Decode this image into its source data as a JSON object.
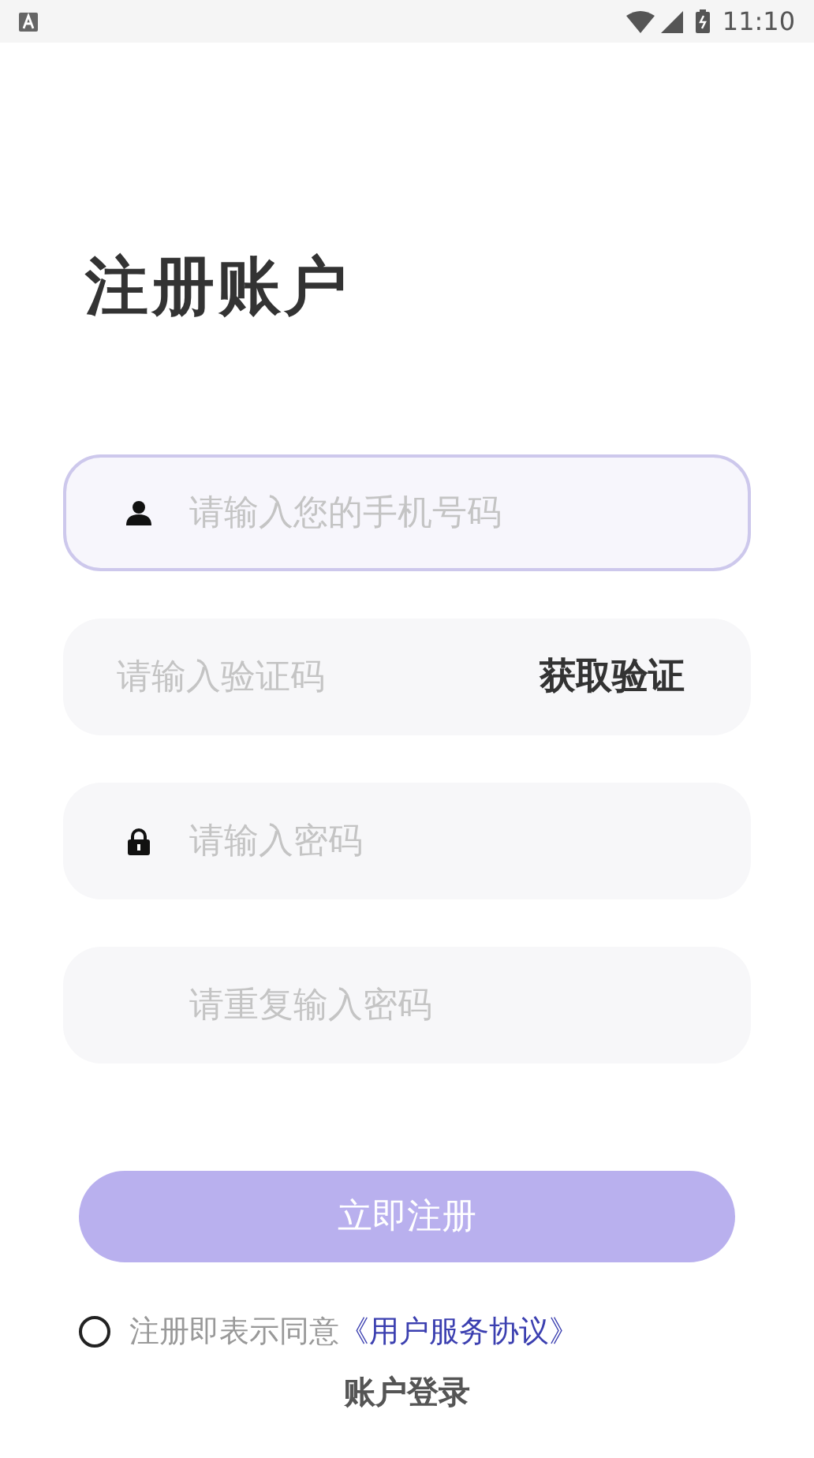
{
  "status_bar": {
    "time": "11:10"
  },
  "title": "注册账户",
  "fields": [
    {
      "kind": "phone",
      "placeholder": "请输入您的手机号码",
      "focused": true
    },
    {
      "kind": "code",
      "placeholder": "请输入验证码",
      "focused": false,
      "action": "获取验证"
    },
    {
      "kind": "password",
      "placeholder": "请输入密码",
      "focused": false
    },
    {
      "kind": "repeat",
      "placeholder": "请重复输入密码",
      "focused": false
    }
  ],
  "register_button": {
    "label": "立即注册",
    "disabled": true
  },
  "agreement": {
    "checked": false,
    "text": "注册即表示同意",
    "link": "《用户服务协议》"
  },
  "login_link": "账户登录"
}
